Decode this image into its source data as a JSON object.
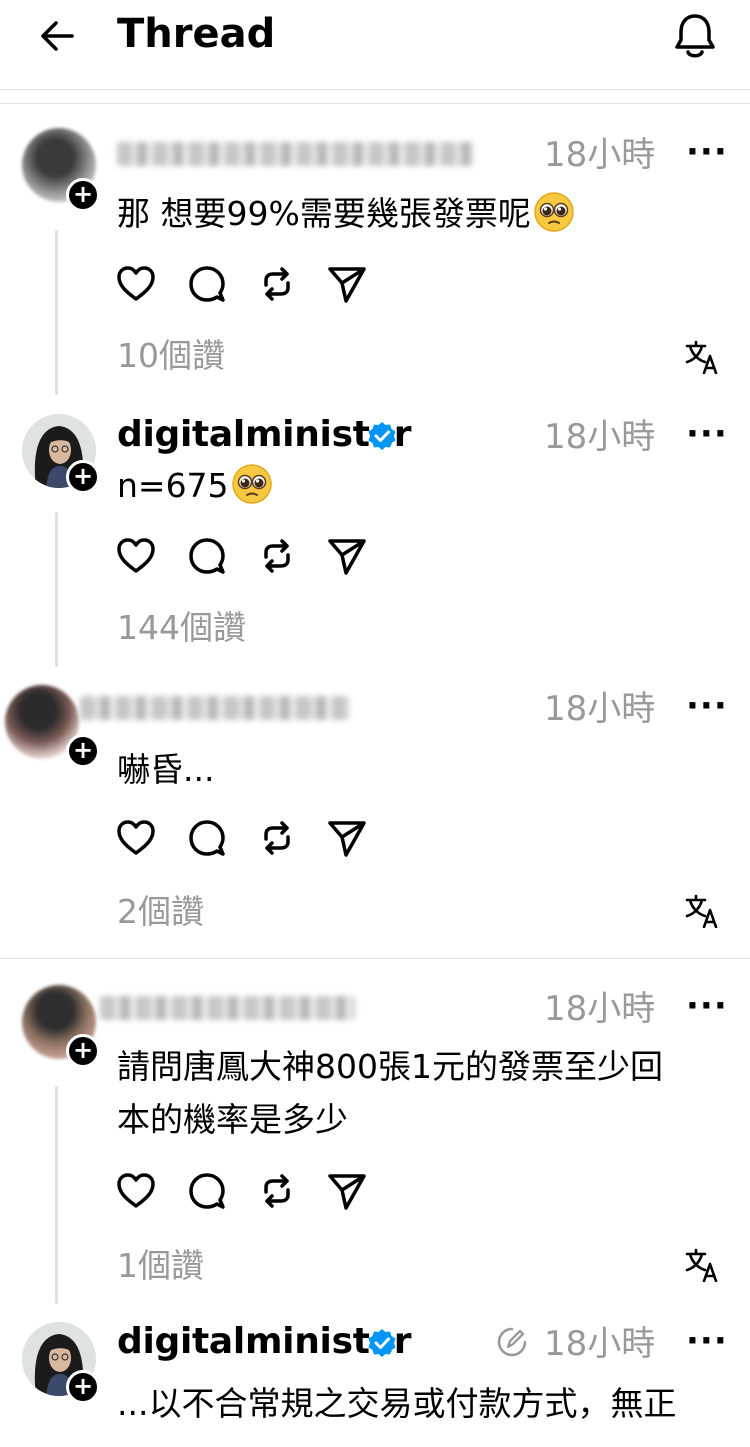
{
  "header": {
    "title": "Thread"
  },
  "posts": [
    {
      "username_visible": false,
      "time": "18小時",
      "more": "···",
      "text": "那 想要99%需要幾張發票呢",
      "likes": "10個讚"
    },
    {
      "username": "digitalminister",
      "time": "18小時",
      "more": "···",
      "text": "n=675",
      "likes": "144個讚"
    },
    {
      "username_visible": false,
      "time": "18小時",
      "more": "···",
      "text": "嚇昏...",
      "likes": "2個讚"
    },
    {
      "username_visible": false,
      "time": "18小時",
      "more": "···",
      "text_line1": "請問唐鳳大神800張1元的發票至少回",
      "text_line2": "本的機率是多少",
      "likes": "1個讚"
    },
    {
      "username": "digitalminister",
      "time": "18小時",
      "more": "···",
      "text": "...以不合常規之交易或付款方式，無正"
    }
  ],
  "icons": [
    "back-arrow-icon",
    "bell-icon",
    "heart-icon",
    "comment-icon",
    "repost-icon",
    "share-icon",
    "translate-icon",
    "verified-badge-icon",
    "edited-icon"
  ]
}
